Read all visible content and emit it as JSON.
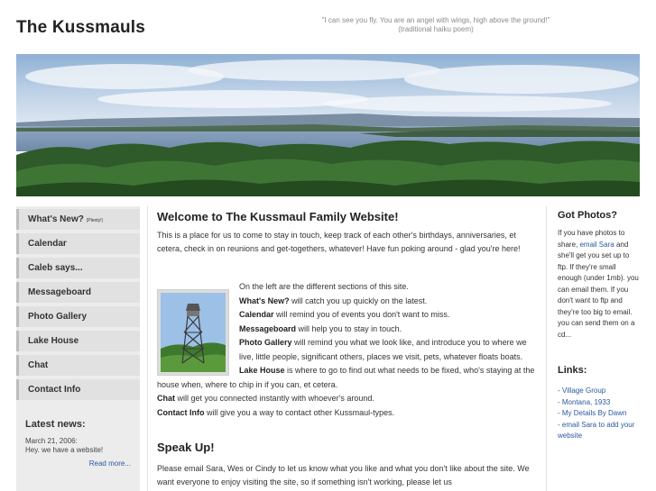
{
  "header": {
    "site_title": "The Kussmauls",
    "quote_line1": "\"I can see you fly. You are an angel with wings, high above the ground!\"",
    "quote_line2": "(traditional haiku poem)"
  },
  "nav": {
    "items": [
      {
        "label": "What's New?",
        "note": "(Plenty!)"
      },
      {
        "label": "Calendar"
      },
      {
        "label": "Caleb says..."
      },
      {
        "label": "Messageboard"
      },
      {
        "label": "Photo Gallery"
      },
      {
        "label": "Lake House"
      },
      {
        "label": "Chat"
      },
      {
        "label": "Contact Info"
      }
    ]
  },
  "news": {
    "title": "Latest news:",
    "date": "March 21, 2006:",
    "text": "Hey. we have a website!",
    "more": "Read more..."
  },
  "main": {
    "welcome": "Welcome to The Kussmaul Family Website!",
    "intro": "This is a place for us to come to stay in touch, keep track of each other's birthdays, anniversaries, et cetera, check in on reunions and get-togethers, whatever! Have fun poking around - glad you're here!",
    "sections_intro": "On the left are the different sections of this site.",
    "sections": [
      {
        "name": "What's New?",
        "desc": " will catch you up quickly on the latest."
      },
      {
        "name": "Calendar",
        "desc": " will remind you of events you don't want to miss."
      },
      {
        "name": "Messageboard",
        "desc": " will help you to stay in touch."
      },
      {
        "name": "Photo Gallery",
        "desc": " will remind you what we look like, and introduce you to where we live, little people, significant others, places we visit, pets, whatever floats boats."
      },
      {
        "name": "Lake House",
        "desc": " is where to go to find out what needs to be fixed, who's staying at the house when, where to chip in if you can, et cetera."
      },
      {
        "name": "Chat",
        "desc": " will get you connected instantly with whoever's around."
      },
      {
        "name": "Contact Info",
        "desc": " will give you a way to contact other Kussmaul-types."
      }
    ],
    "speak_title": "Speak Up!",
    "speak_text": "Please email Sara, Wes or Cindy to let us know what you like and what you don't like about the site. We want everyone to enjoy visiting the site, so if something isn't working, please let us"
  },
  "sidebar_right": {
    "got_title": "Got Photos?",
    "got_text_1": "If you have photos to share, ",
    "got_link": "email Sara",
    "got_text_2": " and she'll get you set up to ftp. If they're small enough (under 1mb). you can email them. If you don't want to ftp and they're too big to email. you can send them on a cd...",
    "links_title": "Links:",
    "links": [
      "- Village Group",
      "- Montana, 1933",
      "- My Details By Dawn",
      "- email Sara to add your website"
    ]
  },
  "colors": {
    "link": "#2a5aa0",
    "nav_bg": "#e1e1e1",
    "left_bg": "#ececec"
  }
}
